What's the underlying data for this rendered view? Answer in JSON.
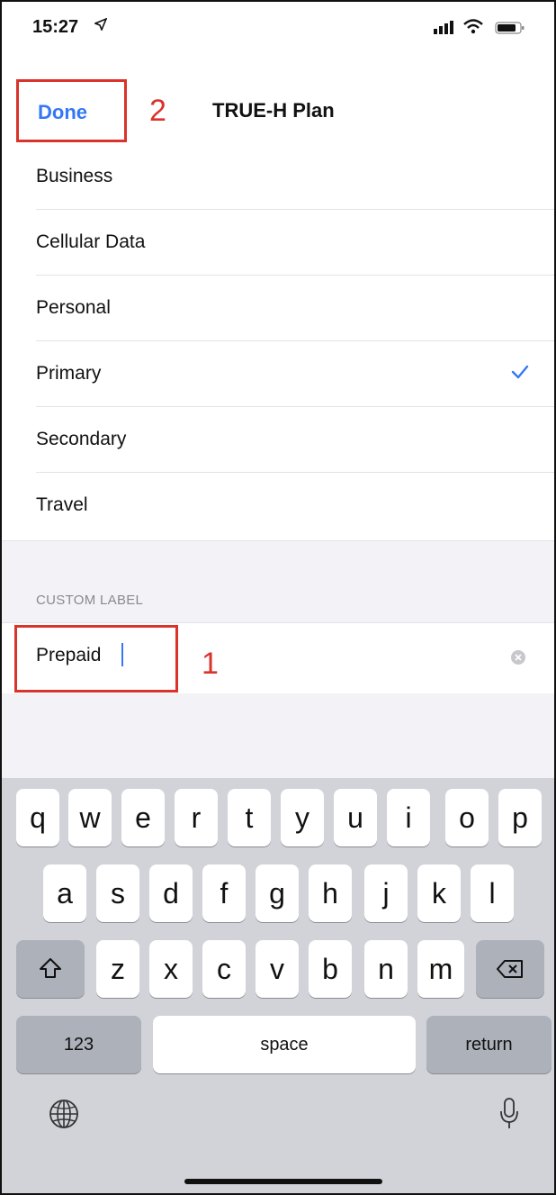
{
  "status_bar": {
    "time": "15:27"
  },
  "nav": {
    "done_label": "Done",
    "title": "TRUE-H Plan"
  },
  "annotations": {
    "num_done": "2",
    "num_field": "1",
    "color": "#d9332b"
  },
  "list": {
    "items": [
      {
        "label": "Business",
        "checked": false
      },
      {
        "label": "Cellular Data",
        "checked": false
      },
      {
        "label": "Personal",
        "checked": false
      },
      {
        "label": "Primary",
        "checked": true
      },
      {
        "label": "Secondary",
        "checked": false
      },
      {
        "label": "Travel",
        "checked": false
      }
    ]
  },
  "custom": {
    "header": "CUSTOM LABEL",
    "value": "Prepaid"
  },
  "keyboard": {
    "row1": [
      "q",
      "w",
      "e",
      "r",
      "t",
      "y",
      "u",
      "i",
      "o",
      "p"
    ],
    "row2": [
      "a",
      "s",
      "d",
      "f",
      "g",
      "h",
      "j",
      "k",
      "l"
    ],
    "row3": [
      "z",
      "x",
      "c",
      "v",
      "b",
      "n",
      "m"
    ],
    "numbers_label": "123",
    "space_label": "space",
    "return_label": "return"
  },
  "colors": {
    "accent": "#3478f6",
    "keyboard_bg": "#d1d3d9"
  }
}
